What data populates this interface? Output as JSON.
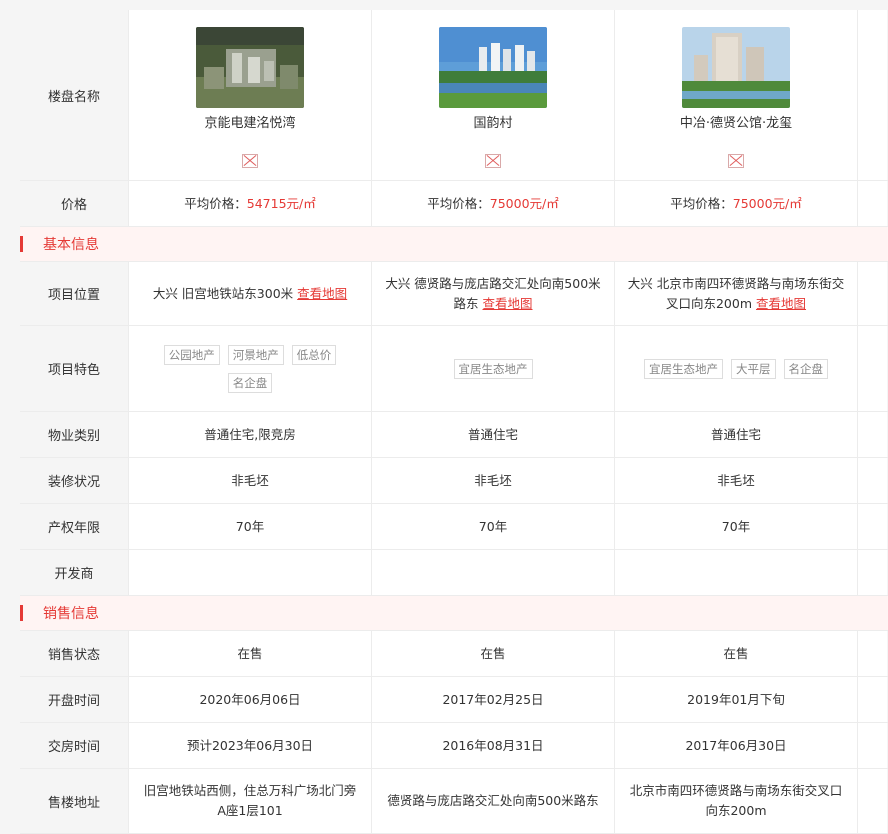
{
  "labels": {
    "name": "楼盘名称",
    "price": "价格",
    "location": "项目位置",
    "features": "项目特色",
    "property_type": "物业类别",
    "decoration": "装修状况",
    "term": "产权年限",
    "developer": "开发商",
    "sale_status": "销售状态",
    "open_time": "开盘时间",
    "delivery_time": "交房时间",
    "sales_address": "售楼地址"
  },
  "sections": {
    "basic": "基本信息",
    "sales": "销售信息"
  },
  "common": {
    "price_prefix": "平均价格：",
    "map_link": "查看地图"
  },
  "properties": [
    {
      "name": "京能电建洺悦湾",
      "price": "54715元/㎡",
      "location": "大兴 旧宫地铁站东300米",
      "features": [
        "公园地产",
        "河景地产",
        "低总价",
        "名企盘"
      ],
      "property_type": "普通住宅,限竞房",
      "decoration": "非毛坯",
      "term": "70年",
      "developer": "",
      "sale_status": "在售",
      "open_time": "2020年06月06日",
      "delivery_time": "预计2023年06月30日",
      "sales_address": "旧宫地铁站西侧，住总万科广场北门旁A座1层101"
    },
    {
      "name": "国韵村",
      "price": "75000元/㎡",
      "location": "大兴 德贤路与庞店路交汇处向南500米路东",
      "features": [
        "宜居生态地产"
      ],
      "property_type": "普通住宅",
      "decoration": "非毛坯",
      "term": "70年",
      "developer": "",
      "sale_status": "在售",
      "open_time": "2017年02月25日",
      "delivery_time": "2016年08月31日",
      "sales_address": "德贤路与庞店路交汇处向南500米路东"
    },
    {
      "name": "中冶·德贤公馆·龙玺",
      "price": "75000元/㎡",
      "location": "大兴 北京市南四环德贤路与南场东街交叉口向东200m",
      "features": [
        "宜居生态地产",
        "大平层",
        "名企盘"
      ],
      "property_type": "普通住宅",
      "decoration": "非毛坯",
      "term": "70年",
      "developer": "",
      "sale_status": "在售",
      "open_time": "2019年01月下旬",
      "delivery_time": "2017年06月30日",
      "sales_address": "北京市南四环德贤路与南场东街交叉口向东200m"
    }
  ]
}
